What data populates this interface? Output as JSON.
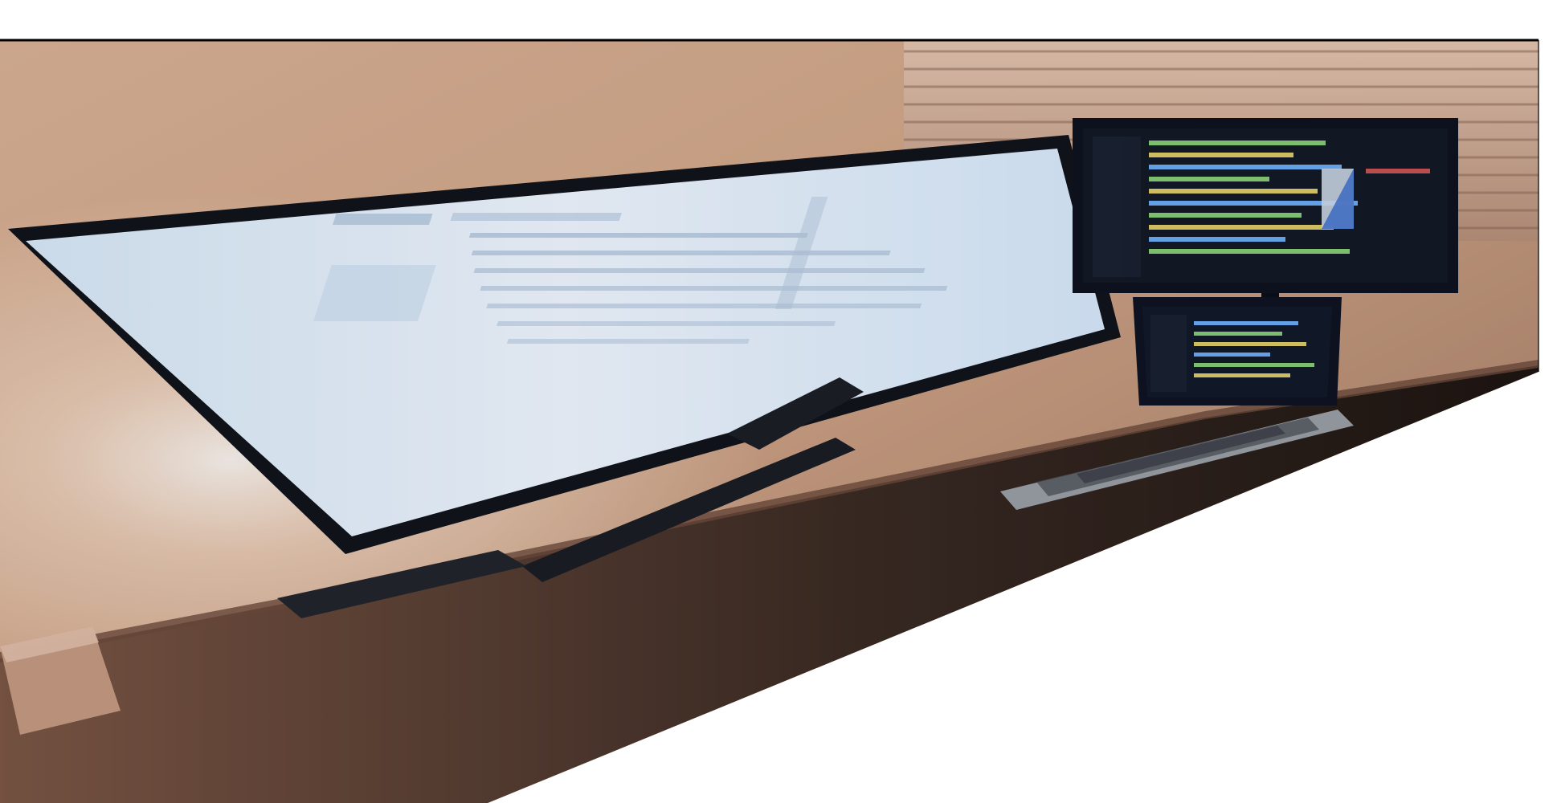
{
  "scene": {
    "kind": "photo",
    "subjects": [
      "ultrawide-monitor",
      "secondary-monitor",
      "laptop",
      "desk",
      "window-blinds",
      "wall"
    ]
  },
  "colors": {
    "wall_light": "#d9b79e",
    "wall_mid": "#c89a7a",
    "wall_dark": "#8f6a55",
    "desk": "#3a2a22",
    "desk_edge": "#6b4a3c",
    "monitor_bezel": "#10141b",
    "screen_light": "#e8f1fb",
    "screen_mid": "#cfe0f1",
    "code_bg": "#141a26",
    "code_green": "#8bd47a",
    "code_yellow": "#e6d36a",
    "code_blue": "#6fb3ff",
    "laptop_body": "#8c8f95",
    "white": "#ffffff"
  }
}
